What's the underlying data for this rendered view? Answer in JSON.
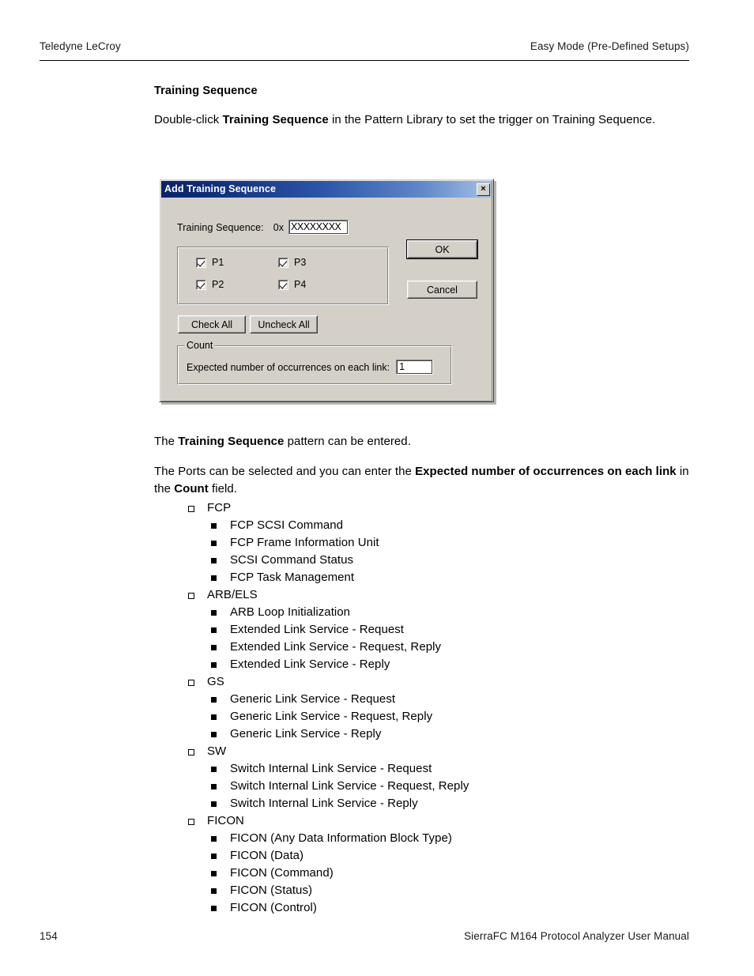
{
  "header": {
    "left": "Teledyne LeCroy",
    "right": "Easy Mode (Pre-Defined Setups)"
  },
  "section": {
    "title": "Training Sequence",
    "intro_pre": "Double-click ",
    "intro_bold": "Training Sequence",
    "intro_post": " in the Pattern Library to set the trigger on Training Sequence."
  },
  "dialog": {
    "title": "Add Training Sequence",
    "close_label": "×",
    "training_sequence_label": "Training Sequence:",
    "hex_prefix": "0x",
    "training_sequence_value": "XXXXXXXX",
    "ports": [
      {
        "label": "P1",
        "checked": true
      },
      {
        "label": "P2",
        "checked": true
      },
      {
        "label": "P3",
        "checked": true
      },
      {
        "label": "P4",
        "checked": true
      }
    ],
    "check_all_label": "Check All",
    "uncheck_all_label": "Uncheck All",
    "ok_label": "OK",
    "cancel_label": "Cancel",
    "count_legend": "Count",
    "count_label": "Expected number of occurrences on each link:",
    "count_value": "1",
    "colors": {
      "face": "#d4d0c8",
      "titlebar_start": "#0a246a",
      "titlebar_end": "#a6c0e4",
      "title_text": "#ffffff"
    }
  },
  "paragraphs": [
    {
      "pre": "The ",
      "bold": "Training Sequence",
      "post": " pattern can be entered."
    }
  ],
  "paragraph2": {
    "pre": "The Ports can be selected and you can enter the ",
    "bold1": "Expected number of occurrences on each link",
    "mid": " in the ",
    "bold2": "Count",
    "post": " field."
  },
  "list": [
    {
      "label": "FCP",
      "children": [
        "FCP SCSI Command",
        "FCP Frame Information Unit",
        "SCSI Command Status",
        "FCP Task Management"
      ]
    },
    {
      "label": "ARB/ELS",
      "children": [
        "ARB Loop Initialization",
        "Extended Link Service - Request",
        "Extended Link Service - Request, Reply",
        "Extended Link Service - Reply"
      ]
    },
    {
      "label": "GS",
      "children": [
        "Generic Link Service - Request",
        "Generic Link Service - Request, Reply",
        "Generic Link Service - Reply"
      ]
    },
    {
      "label": "SW",
      "children": [
        "Switch Internal Link Service - Request",
        "Switch Internal Link Service - Request, Reply",
        "Switch Internal Link Service - Reply"
      ]
    },
    {
      "label": "FICON",
      "children": [
        "FICON (Any Data Information Block Type)",
        "FICON (Data)",
        "FICON (Command)",
        "FICON (Status)",
        "FICON (Control)"
      ]
    }
  ],
  "footer": {
    "page_number": "154",
    "manual_title": "SierraFC M164 Protocol Analyzer User Manual"
  }
}
